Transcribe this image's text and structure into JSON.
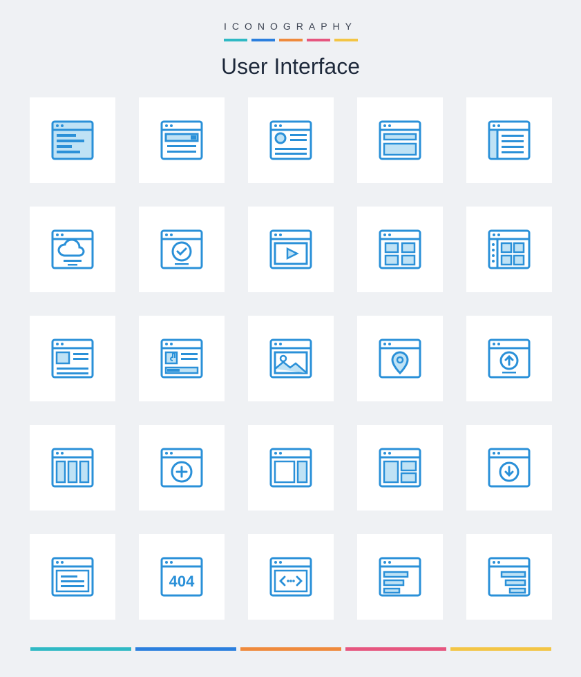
{
  "header": {
    "label": "ICONOGRAPHY",
    "title": "User Interface"
  },
  "colors": {
    "teal": "#2fb9c4",
    "blue": "#2b7fde",
    "orange": "#ef8a3c",
    "pink": "#e6567f",
    "yellow": "#f3c545",
    "iconStroke": "#2a90d8",
    "iconFill": "#bfe2f5",
    "tileBg": "#ffffff",
    "pageBg": "#eff1f4"
  },
  "icons": [
    {
      "name": "browser-code-lines-icon"
    },
    {
      "name": "browser-search-field-icon"
    },
    {
      "name": "browser-profile-card-icon"
    },
    {
      "name": "browser-banner-page-icon"
    },
    {
      "name": "browser-sidebar-list-icon"
    },
    {
      "name": "browser-cloud-icon"
    },
    {
      "name": "browser-checkmark-icon"
    },
    {
      "name": "browser-video-play-icon"
    },
    {
      "name": "browser-grid-four-icon"
    },
    {
      "name": "browser-side-grid-icon"
    },
    {
      "name": "browser-article-card-icon"
    },
    {
      "name": "browser-music-player-icon"
    },
    {
      "name": "browser-image-icon"
    },
    {
      "name": "browser-map-pin-icon"
    },
    {
      "name": "browser-upload-icon"
    },
    {
      "name": "browser-three-columns-icon"
    },
    {
      "name": "browser-add-plus-icon"
    },
    {
      "name": "browser-main-sidebar-icon"
    },
    {
      "name": "browser-mixed-layout-icon"
    },
    {
      "name": "browser-download-icon"
    },
    {
      "name": "browser-text-block-icon"
    },
    {
      "name": "browser-404-error-icon"
    },
    {
      "name": "browser-code-brackets-icon"
    },
    {
      "name": "browser-rows-left-icon"
    },
    {
      "name": "browser-rows-right-icon"
    }
  ]
}
